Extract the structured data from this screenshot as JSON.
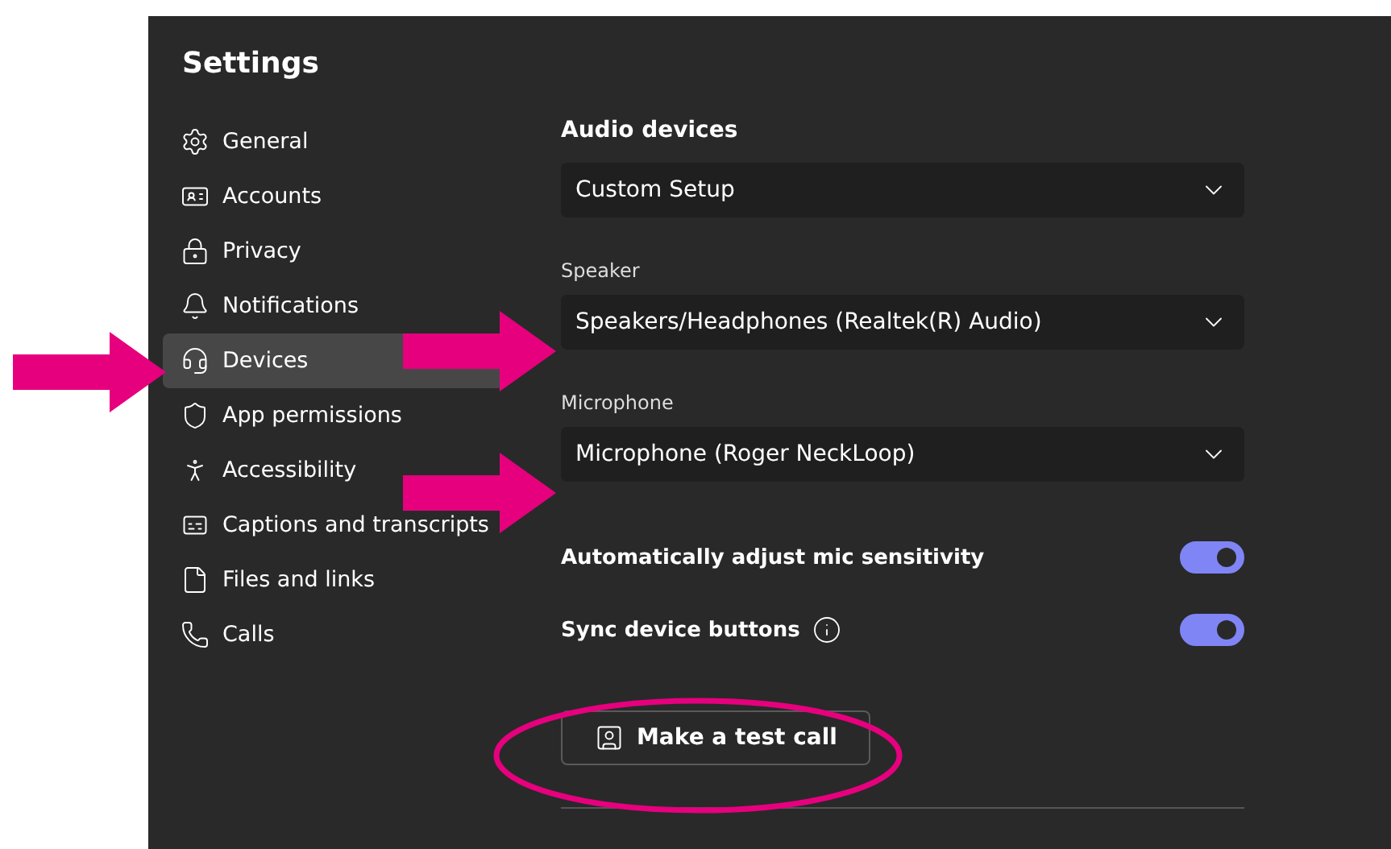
{
  "window": {
    "title": "Settings"
  },
  "sidebar": {
    "items": [
      {
        "label": "General",
        "selected": false
      },
      {
        "label": "Accounts",
        "selected": false
      },
      {
        "label": "Privacy",
        "selected": false
      },
      {
        "label": "Notifications",
        "selected": false
      },
      {
        "label": "Devices",
        "selected": true
      },
      {
        "label": "App permissions",
        "selected": false
      },
      {
        "label": "Accessibility",
        "selected": false
      },
      {
        "label": "Captions and transcripts",
        "selected": false
      },
      {
        "label": "Files and links",
        "selected": false
      },
      {
        "label": "Calls",
        "selected": false
      }
    ]
  },
  "audio_devices": {
    "heading": "Audio devices",
    "value": "Custom Setup"
  },
  "fields": [
    {
      "label": "Speaker",
      "value": "Speakers/Headphones (Realtek(R) Audio)"
    },
    {
      "label": "Microphone",
      "value": "Microphone (Roger NeckLoop)"
    }
  ],
  "toggles": [
    {
      "label": "Automatically adjust mic sensitivity",
      "on": true,
      "info": false
    },
    {
      "label": "Sync device buttons",
      "on": true,
      "info": true
    }
  ],
  "test_call_button": {
    "label": "Make a test call"
  },
  "annotations": [
    {
      "kind": "arrow"
    },
    {
      "kind": "arrow"
    },
    {
      "kind": "arrow"
    },
    {
      "kind": "ellipse"
    }
  ]
}
